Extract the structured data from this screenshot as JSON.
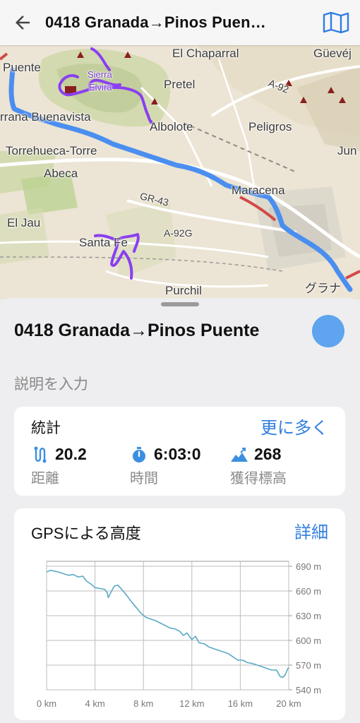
{
  "header": {
    "title": "0418 Granada→Pinos Puen…",
    "back_icon": "arrow-left-icon",
    "map_icon": "map-icon"
  },
  "map": {
    "labels": [
      {
        "text": "Puente",
        "cls": ""
      },
      {
        "text": "El Chaparral",
        "cls": ""
      },
      {
        "text": "Güevéj",
        "cls": ""
      },
      {
        "text": "Sierra",
        "cls": "purple"
      },
      {
        "text": "Elvira",
        "cls": "purple"
      },
      {
        "text": "Pretel",
        "cls": ""
      },
      {
        "text": "A-92",
        "cls": ""
      },
      {
        "text": "rrana Buenavista",
        "cls": ""
      },
      {
        "text": "Albolote",
        "cls": ""
      },
      {
        "text": "Peligros",
        "cls": ""
      },
      {
        "text": "Torrehueca-Torre",
        "cls": ""
      },
      {
        "text": "Jun",
        "cls": ""
      },
      {
        "text": "Abeca",
        "cls": ""
      },
      {
        "text": "Maracena",
        "cls": ""
      },
      {
        "text": "GR-43",
        "cls": ""
      },
      {
        "text": "El Jau",
        "cls": ""
      },
      {
        "text": "A-92G",
        "cls": ""
      },
      {
        "text": "Santa Fe",
        "cls": ""
      },
      {
        "text": "Purchil",
        "cls": ""
      },
      {
        "text": "グラナ",
        "cls": ""
      }
    ],
    "route_color": "#4a8ef0",
    "track_color": "#8a3ff0"
  },
  "sheet": {
    "title": "0418 Granada→Pinos Puente",
    "description_placeholder": "説明を入力",
    "color_dot": "#5ea4ee"
  },
  "stats": {
    "title": "統計",
    "more_label": "更に多く",
    "items": [
      {
        "icon": "distance-icon",
        "value": "20.2",
        "label": "距離"
      },
      {
        "icon": "stopwatch-icon",
        "value": "6:03:0",
        "label": "時間"
      },
      {
        "icon": "elevation-gain-icon",
        "value": "268",
        "label": "獲得標高"
      }
    ]
  },
  "elevation": {
    "title_latin": "GPS",
    "title_jp": "による高度",
    "detail_label": "詳細"
  },
  "chart_data": {
    "type": "line",
    "x_unit": "km",
    "y_unit": "m",
    "xlim": [
      0,
      20
    ],
    "ylim": [
      540,
      690
    ],
    "x_ticks": [
      "0 km",
      "4 km",
      "8 km",
      "12 km",
      "16 km",
      "20 km"
    ],
    "y_ticks": [
      "690 m",
      "660 m",
      "630 m",
      "600 m",
      "570 m",
      "540 m"
    ],
    "line_color": "#5aa9c4",
    "grid": true,
    "series": [
      {
        "x": [
          0,
          0.3,
          0.7,
          1.0,
          1.4,
          1.8,
          2.2,
          2.6,
          3.0,
          3.3,
          3.7,
          4.0,
          4.4,
          4.8,
          5.0,
          5.1,
          5.3,
          5.6,
          5.9,
          6.2,
          6.6,
          7.0,
          7.4,
          7.8,
          8.2,
          8.6,
          9.0,
          9.4,
          9.8,
          10.2,
          10.6,
          11.0,
          11.3,
          11.6,
          12.0,
          12.3,
          12.6,
          13.0,
          13.4,
          13.8,
          14.2,
          14.6,
          15.0,
          15.4,
          15.8,
          16.2,
          16.6,
          17.0,
          17.4,
          17.8,
          18.2,
          18.6,
          19.0,
          19.3,
          19.5,
          19.7,
          19.9,
          20.0
        ],
        "y": [
          683,
          685,
          684,
          683,
          681,
          679,
          680,
          677,
          678,
          672,
          668,
          664,
          663,
          662,
          658,
          652,
          658,
          666,
          667,
          662,
          655,
          647,
          640,
          633,
          628,
          626,
          624,
          621,
          618,
          615,
          614,
          611,
          606,
          609,
          601,
          605,
          597,
          596,
          592,
          590,
          588,
          586,
          584,
          580,
          576,
          576,
          573,
          572,
          570,
          568,
          566,
          564,
          564,
          556,
          555,
          558,
          565,
          567
        ]
      }
    ]
  }
}
